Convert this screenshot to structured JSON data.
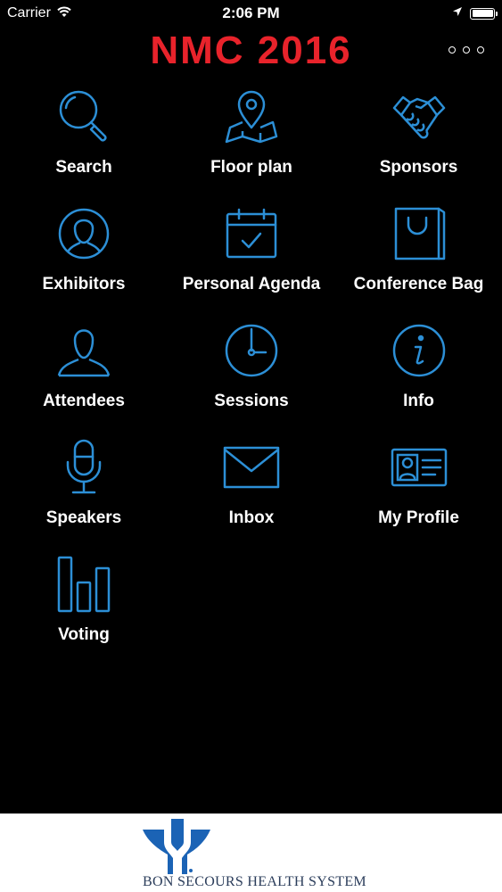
{
  "status_bar": {
    "carrier": "Carrier",
    "time": "2:06 PM",
    "wifi_icon": "wifi-icon",
    "location_icon": "location-arrow-icon",
    "battery_icon": "battery-icon"
  },
  "header": {
    "title": "NMC 2016",
    "title_color": "#e8232b",
    "more_icon": "more-dots-icon"
  },
  "accent_color": "#2c8fd6",
  "menu": [
    {
      "label": "Search",
      "icon": "search-icon"
    },
    {
      "label": "Floor plan",
      "icon": "map-pin-icon"
    },
    {
      "label": "Sponsors",
      "icon": "handshake-icon"
    },
    {
      "label": "Exhibitors",
      "icon": "exhibitor-icon"
    },
    {
      "label": "Personal Agenda",
      "icon": "calendar-check-icon"
    },
    {
      "label": "Conference Bag",
      "icon": "bag-icon"
    },
    {
      "label": "Attendees",
      "icon": "person-icon"
    },
    {
      "label": "Sessions",
      "icon": "clock-icon"
    },
    {
      "label": "Info",
      "icon": "info-icon"
    },
    {
      "label": "Speakers",
      "icon": "microphone-icon"
    },
    {
      "label": "Inbox",
      "icon": "envelope-icon"
    },
    {
      "label": "My Profile",
      "icon": "id-card-icon"
    },
    {
      "label": "Voting",
      "icon": "bar-chart-icon"
    }
  ],
  "footer": {
    "brand_text": "BON SECOURS HEALTH SYSTEM",
    "logo_icon": "bon-secours-logo",
    "logo_color": "#1b63b5"
  }
}
